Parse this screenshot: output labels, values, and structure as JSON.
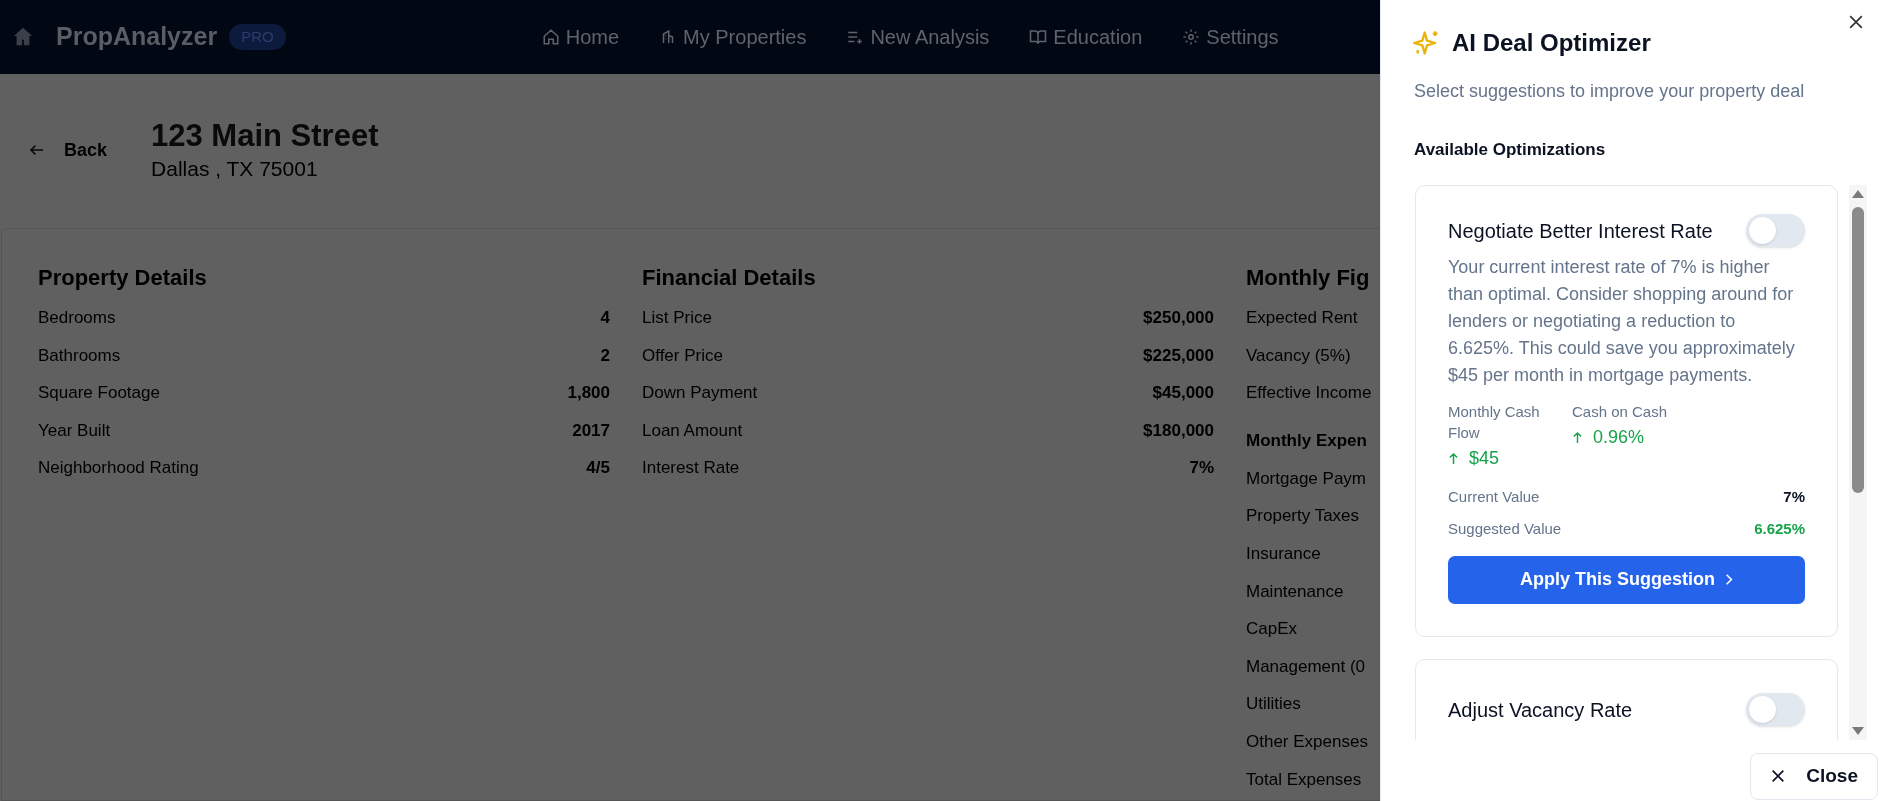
{
  "app": {
    "name": "PropAnalyzer",
    "badge": "PRO"
  },
  "nav": [
    {
      "label": "Home"
    },
    {
      "label": "My Properties"
    },
    {
      "label": "New Analysis"
    },
    {
      "label": "Education"
    },
    {
      "label": "Settings"
    }
  ],
  "back": "Back",
  "property": {
    "address": "123 Main Street",
    "city": "Dallas , TX 75001"
  },
  "sections": [
    {
      "title": "Property Details",
      "rows": [
        {
          "kind": "row",
          "label": "Bedrooms",
          "value": "4"
        },
        {
          "kind": "row",
          "label": "Bathrooms",
          "value": "2"
        },
        {
          "kind": "row",
          "label": "Square Footage",
          "value": "1,800"
        },
        {
          "kind": "row",
          "label": "Year Built",
          "value": "2017"
        },
        {
          "kind": "row",
          "label": "Neighborhood Rating",
          "value": "4/5"
        }
      ]
    },
    {
      "title": "Financial Details",
      "rows": [
        {
          "kind": "row",
          "label": "List Price",
          "value": "$250,000"
        },
        {
          "kind": "row",
          "label": "Offer Price",
          "value": "$225,000"
        },
        {
          "kind": "row",
          "label": "Down Payment",
          "value": "$45,000"
        },
        {
          "kind": "row",
          "label": "Loan Amount",
          "value": "$180,000"
        },
        {
          "kind": "row",
          "label": "Interest Rate",
          "value": "7%"
        }
      ]
    },
    {
      "title": "Monthly Fig",
      "rows": [
        {
          "kind": "row",
          "label": "Expected Rent"
        },
        {
          "kind": "row",
          "label": "Vacancy (5%)"
        },
        {
          "kind": "row",
          "label": "Effective Income"
        },
        {
          "kind": "heading",
          "label": "Monthly Expen"
        },
        {
          "kind": "row",
          "label": "Mortgage Paym"
        },
        {
          "kind": "row",
          "label": "Property Taxes"
        },
        {
          "kind": "row",
          "label": "Insurance"
        },
        {
          "kind": "row",
          "label": "Maintenance"
        },
        {
          "kind": "row",
          "label": "CapEx"
        },
        {
          "kind": "row",
          "label": "Management (0"
        },
        {
          "kind": "row",
          "label": "Utilities"
        },
        {
          "kind": "row",
          "label": "Other Expenses"
        },
        {
          "kind": "row",
          "label": "Total Expenses"
        }
      ]
    }
  ],
  "panel": {
    "title": "AI Deal Optimizer",
    "subtitle": "Select suggestions to improve your property deal",
    "section_title": "Available Optimizations",
    "optimizations": [
      {
        "title": "Negotiate Better Interest Rate",
        "on": false,
        "description": "Your current interest rate of 7% is higher than optimal. Consider shopping around for lenders or negotiating a reduction to 6.625%. This could save you approximately $45 per month in mortgage payments.",
        "metrics": [
          {
            "label": "Monthly Cash Flow",
            "value": "$45"
          },
          {
            "label": "Cash on Cash",
            "value": "0.96%"
          }
        ],
        "current": {
          "label": "Current Value",
          "value": "7%"
        },
        "suggested": {
          "label": "Suggested Value",
          "value": "6.625%"
        },
        "button": "Apply This Suggestion"
      },
      {
        "title": "Adjust Vacancy Rate",
        "on": false
      }
    ],
    "close": "Close"
  }
}
